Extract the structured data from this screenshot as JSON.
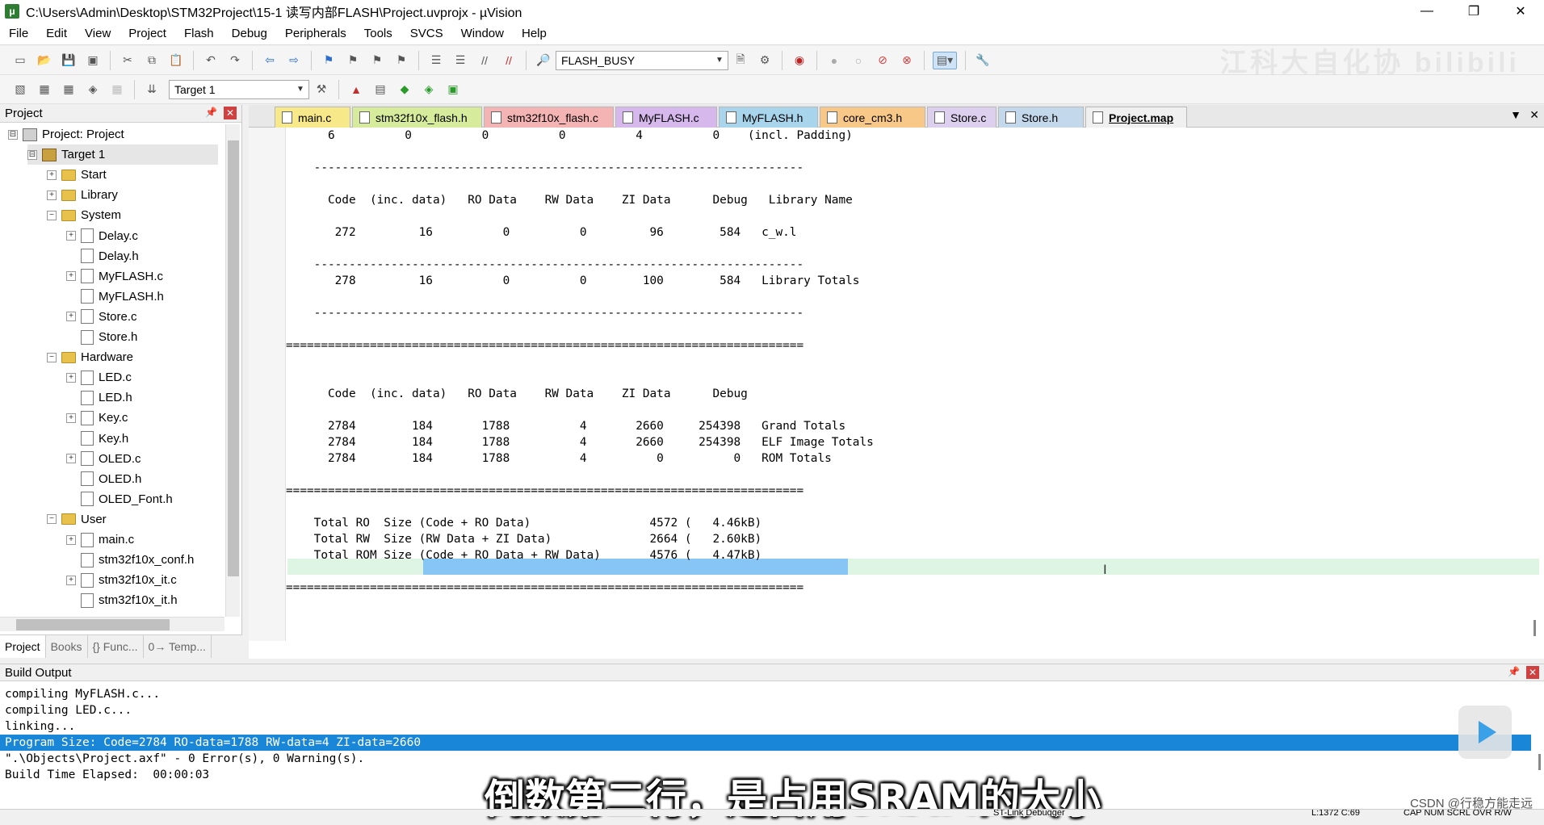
{
  "window": {
    "title": "C:\\Users\\Admin\\Desktop\\STM32Project\\15-1 读写内部FLASH\\Project.uvprojx - µVision",
    "controls": [
      "—",
      "❐",
      "✕"
    ]
  },
  "menu": [
    "File",
    "Edit",
    "View",
    "Project",
    "Flash",
    "Debug",
    "Peripherals",
    "Tools",
    "SVCS",
    "Window",
    "Help"
  ],
  "toolbar": {
    "find_value": "FLASH_BUSY",
    "target_value": "Target 1"
  },
  "watermark": "江科大自化协 bilibili",
  "project_panel": {
    "title": "Project",
    "tree": [
      {
        "label": "Project: Project",
        "level": 0,
        "kind": "project",
        "exp": "⊟"
      },
      {
        "label": "Target 1",
        "level": 1,
        "kind": "target",
        "exp": "⊟"
      },
      {
        "label": "Start",
        "level": 2,
        "kind": "folder",
        "exp": "+"
      },
      {
        "label": "Library",
        "level": 2,
        "kind": "folder",
        "exp": "+"
      },
      {
        "label": "System",
        "level": 2,
        "kind": "folder",
        "exp": "−"
      },
      {
        "label": "Delay.c",
        "level": 3,
        "kind": "file",
        "exp": "+"
      },
      {
        "label": "Delay.h",
        "level": 3,
        "kind": "file",
        "exp": ""
      },
      {
        "label": "MyFLASH.c",
        "level": 3,
        "kind": "file",
        "exp": "+"
      },
      {
        "label": "MyFLASH.h",
        "level": 3,
        "kind": "file",
        "exp": ""
      },
      {
        "label": "Store.c",
        "level": 3,
        "kind": "file",
        "exp": "+"
      },
      {
        "label": "Store.h",
        "level": 3,
        "kind": "file",
        "exp": ""
      },
      {
        "label": "Hardware",
        "level": 2,
        "kind": "folder",
        "exp": "−"
      },
      {
        "label": "LED.c",
        "level": 3,
        "kind": "file",
        "exp": "+"
      },
      {
        "label": "LED.h",
        "level": 3,
        "kind": "file",
        "exp": ""
      },
      {
        "label": "Key.c",
        "level": 3,
        "kind": "file",
        "exp": "+"
      },
      {
        "label": "Key.h",
        "level": 3,
        "kind": "file",
        "exp": ""
      },
      {
        "label": "OLED.c",
        "level": 3,
        "kind": "file",
        "exp": "+"
      },
      {
        "label": "OLED.h",
        "level": 3,
        "kind": "file",
        "exp": ""
      },
      {
        "label": "OLED_Font.h",
        "level": 3,
        "kind": "file",
        "exp": ""
      },
      {
        "label": "User",
        "level": 2,
        "kind": "folder",
        "exp": "−"
      },
      {
        "label": "main.c",
        "level": 3,
        "kind": "file",
        "exp": "+"
      },
      {
        "label": "stm32f10x_conf.h",
        "level": 3,
        "kind": "file",
        "exp": ""
      },
      {
        "label": "stm32f10x_it.c",
        "level": 3,
        "kind": "file",
        "exp": "+"
      },
      {
        "label": "stm32f10x_it.h",
        "level": 3,
        "kind": "file",
        "exp": ""
      }
    ],
    "tabs": [
      "Project",
      "Books",
      "{} Func...",
      "0→ Temp..."
    ]
  },
  "editor_tabs": [
    {
      "label": "main.c",
      "color": "#f7e889",
      "active": false
    },
    {
      "label": "stm32f10x_flash.h",
      "color": "#d6ec9c",
      "active": false
    },
    {
      "label": "stm32f10x_flash.c",
      "color": "#f5b4b4",
      "active": false
    },
    {
      "label": "MyFLASH.c",
      "color": "#d6b8ec",
      "active": false
    },
    {
      "label": "MyFLASH.h",
      "color": "#a8d4ec",
      "active": false
    },
    {
      "label": "core_cm3.h",
      "color": "#f8c888",
      "active": false
    },
    {
      "label": "Store.c",
      "color": "#dcd0ee",
      "active": false
    },
    {
      "label": "Store.h",
      "color": "#c4d8ec",
      "active": false
    },
    {
      "label": "Project.map",
      "color": "#f0f0f0",
      "active": true
    }
  ],
  "editor_lines": [
    "      6          0          0          0          4          0    (incl. Padding)",
    "",
    "    ----------------------------------------------------------------------",
    "",
    "      Code  (inc. data)   RO Data    RW Data    ZI Data      Debug   Library Name",
    "",
    "       272         16          0          0         96        584   c_w.l",
    "",
    "    ----------------------------------------------------------------------",
    "       278         16          0          0        100        584   Library Totals",
    "",
    "    ----------------------------------------------------------------------",
    "",
    "==========================================================================",
    "",
    "",
    "      Code  (inc. data)   RO Data    RW Data    ZI Data      Debug",
    "",
    "      2784        184       1788          4       2660     254398   Grand Totals",
    "      2784        184       1788          4       2660     254398   ELF Image Totals",
    "      2784        184       1788          4          0          0   ROM Totals",
    "",
    "==========================================================================",
    "",
    "    Total RO  Size (Code + RO Data)                 4572 (   4.46kB)",
    "    Total RW  Size (RW Data + ZI Data)              2664 (   2.60kB)",
    "    Total ROM Size (Code + RO Data + RW Data)       4576 (   4.47kB)",
    "",
    "=========================================================================="
  ],
  "build_output": {
    "title": "Build Output",
    "lines": [
      "compiling MyFLASH.c...",
      "compiling LED.c...",
      "linking...",
      "Program Size: Code=2784 RO-data=1788 RW-data=4 ZI-data=2660",
      "\".\\Objects\\Project.axf\" - 0 Error(s), 0 Warning(s).",
      "Build Time Elapsed:  00:00:03"
    ],
    "selected_line_index": 3
  },
  "subtitle": "倒数第二行，是占用SRAM的大小",
  "csdn_credit": "CSDN @行稳方能走远",
  "status": {
    "debugger": "ST-Link Debugger",
    "position": "L:1372 C:69",
    "flags": "CAP  NUM  SCRL  OVR  R/W"
  }
}
